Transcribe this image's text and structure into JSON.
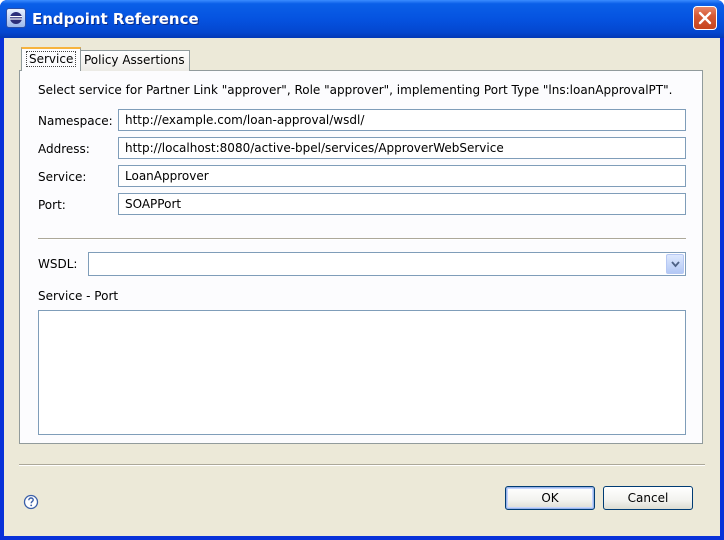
{
  "window": {
    "title": "Endpoint Reference",
    "title_icon": "eclipse-app-icon",
    "close_icon": "close-icon"
  },
  "tabs": [
    {
      "label": "Service",
      "active": true
    },
    {
      "label": "Policy Assertions",
      "active": false
    }
  ],
  "service": {
    "description": "Select service for Partner Link \"approver\", Role \"approver\", implementing Port Type \"lns:loanApprovalPT\".",
    "fields": {
      "namespace": {
        "label": "Namespace:",
        "value": "http://example.com/loan-approval/wsdl/"
      },
      "address": {
        "label": "Address:",
        "value": "http://localhost:8080/active-bpel/services/ApproverWebService"
      },
      "service": {
        "label": "Service:",
        "value": "LoanApprover"
      },
      "port": {
        "label": "Port:",
        "value": "SOAPPort"
      }
    },
    "wsdl": {
      "label": "WSDL:",
      "value": ""
    },
    "service_port": {
      "label": "Service - Port",
      "items": []
    }
  },
  "footer": {
    "help_icon": "help-icon",
    "ok_label": "OK",
    "cancel_label": "Cancel"
  },
  "colors": {
    "titlebar": "#0553e0",
    "dialog_bg": "#ece9d8",
    "panel_bg": "#fcfcfe",
    "active_tab_accent": "#f7b33d",
    "input_border": "#7f9db9"
  }
}
